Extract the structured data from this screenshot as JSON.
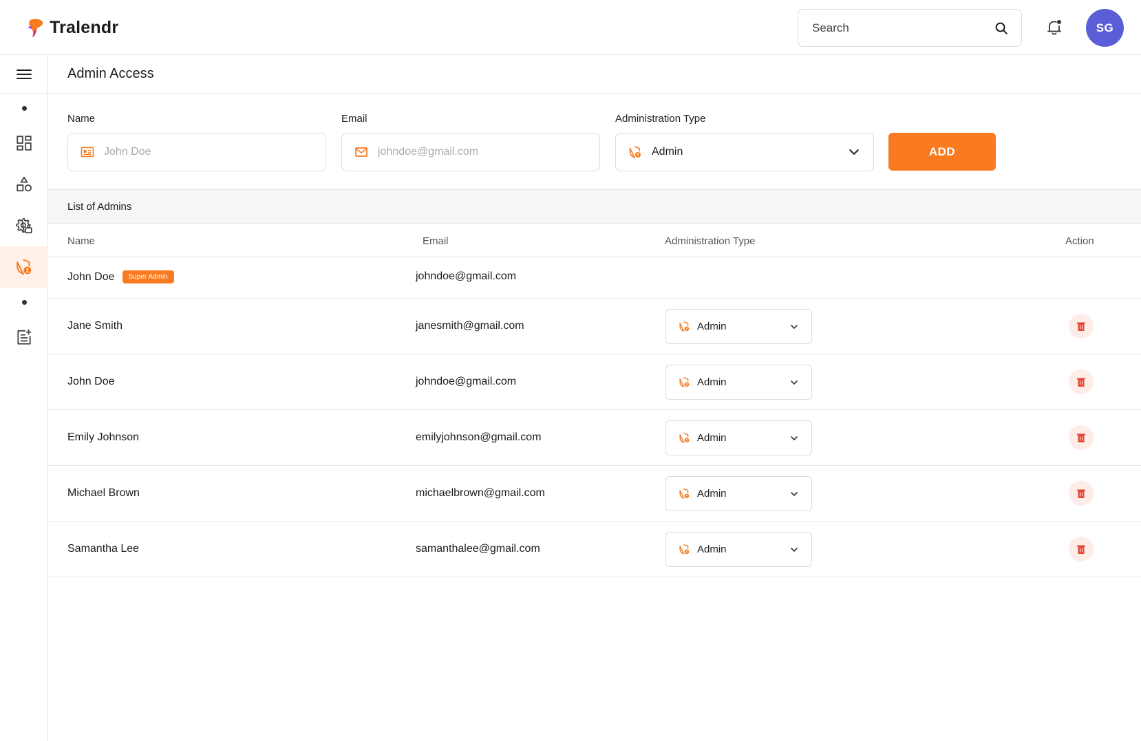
{
  "app": {
    "name": "Tralendr"
  },
  "header": {
    "search_placeholder": "Search",
    "avatar_initials": "SG"
  },
  "sidebar": {
    "items": [
      {
        "icon": "dashboard-icon",
        "active": false
      },
      {
        "icon": "shapes-icon",
        "active": false
      },
      {
        "icon": "settings-user-icon",
        "active": false
      },
      {
        "icon": "shield-user-icon",
        "active": true
      },
      {
        "icon": "document-add-icon",
        "active": false
      }
    ]
  },
  "page": {
    "title": "Admin Access"
  },
  "form": {
    "name_label": "Name",
    "name_placeholder": "John Doe",
    "email_label": "Email",
    "email_placeholder": "johndoe@gmail.com",
    "type_label": "Administration Type",
    "type_value": "Admin",
    "add_label": "ADD"
  },
  "list": {
    "title": "List of Admins",
    "columns": {
      "name": "Name",
      "email": "Email",
      "type": "Administration Type",
      "action": "Action"
    },
    "rows": [
      {
        "name": "John Doe",
        "badge": "Super Admin",
        "email": "johndoe@gmail.com",
        "type": ""
      },
      {
        "name": "Jane Smith",
        "badge": "",
        "email": "janesmith@gmail.com",
        "type": "Admin"
      },
      {
        "name": "John Doe",
        "badge": "",
        "email": "johndoe@gmail.com",
        "type": "Admin"
      },
      {
        "name": "Emily Johnson",
        "badge": "",
        "email": "emilyjohnson@gmail.com",
        "type": "Admin"
      },
      {
        "name": "Michael Brown",
        "badge": "",
        "email": "michaelbrown@gmail.com",
        "type": "Admin"
      },
      {
        "name": "Samantha Lee",
        "badge": "",
        "email": "samanthalee@gmail.com",
        "type": "Admin"
      }
    ]
  },
  "colors": {
    "accent": "#f97a1f",
    "avatar": "#5a5fd8",
    "delete": "#e8452f"
  }
}
